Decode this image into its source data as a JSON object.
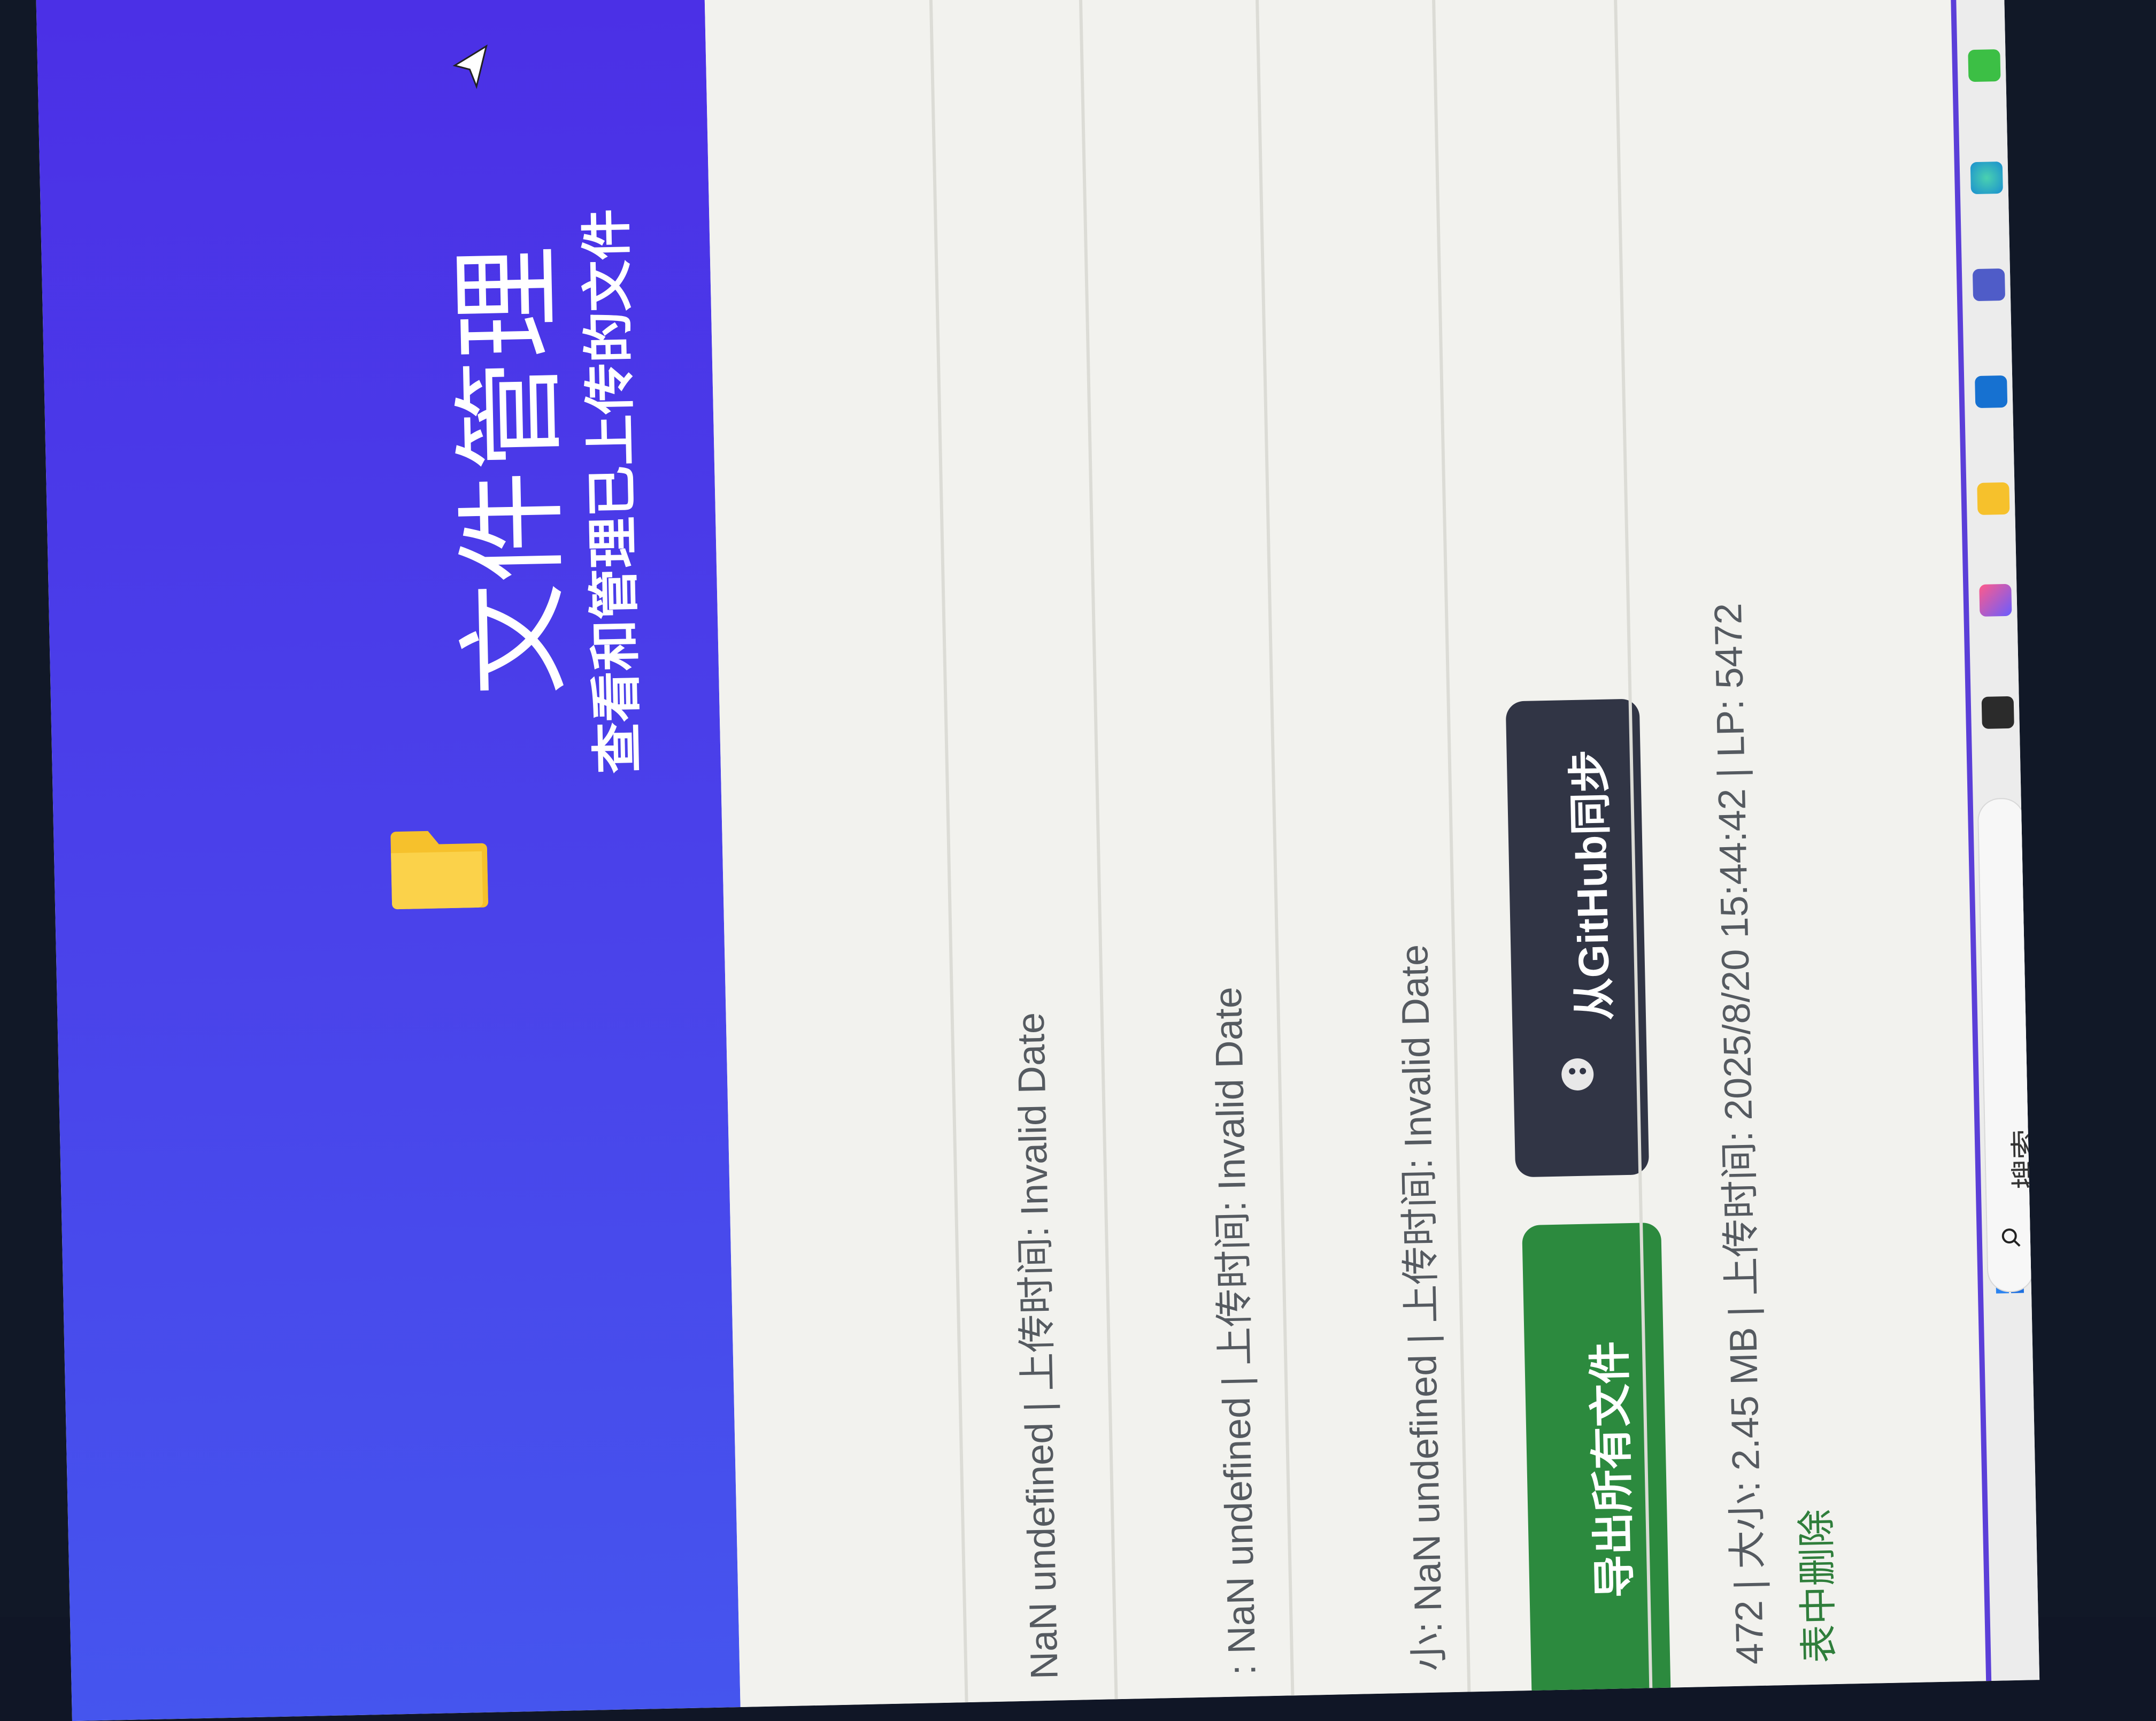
{
  "header": {
    "title": "文件管理",
    "subtitle": "查看和管理已上传的文件"
  },
  "toolbar": {
    "github_sync_label": "从GitHub同步",
    "export_all_label": "导出所有文件"
  },
  "files": [
    {
      "meta": "NaN undefined | 上传时间: Invalid Date"
    },
    {
      "meta": ": NaN undefined | 上传时间: Invalid Date"
    },
    {
      "meta": "小: NaN undefined | 上传时间: Invalid Date"
    },
    {
      "meta": "472 | 大小: 2.45 MB | 上传时间: 2025/8/20 15:44:42 | LP: 5472"
    }
  ],
  "actions": {
    "delete_selected_label": "表中删除"
  },
  "taskbar": {
    "search_label": "搜索",
    "icons": [
      "windows-start-icon",
      "search-icon",
      "file-explorer-icon",
      "store-icon",
      "folder-icon",
      "outlook-icon",
      "teams-icon",
      "edge-icon",
      "wechat-icon",
      "capcut-icon"
    ]
  },
  "colors": {
    "header_gradient_start": "#4b2fe6",
    "header_gradient_end": "#4555ee",
    "github_button": "#313545",
    "export_button": "#2c8a3e",
    "folder_icon": "#f6c12c"
  }
}
